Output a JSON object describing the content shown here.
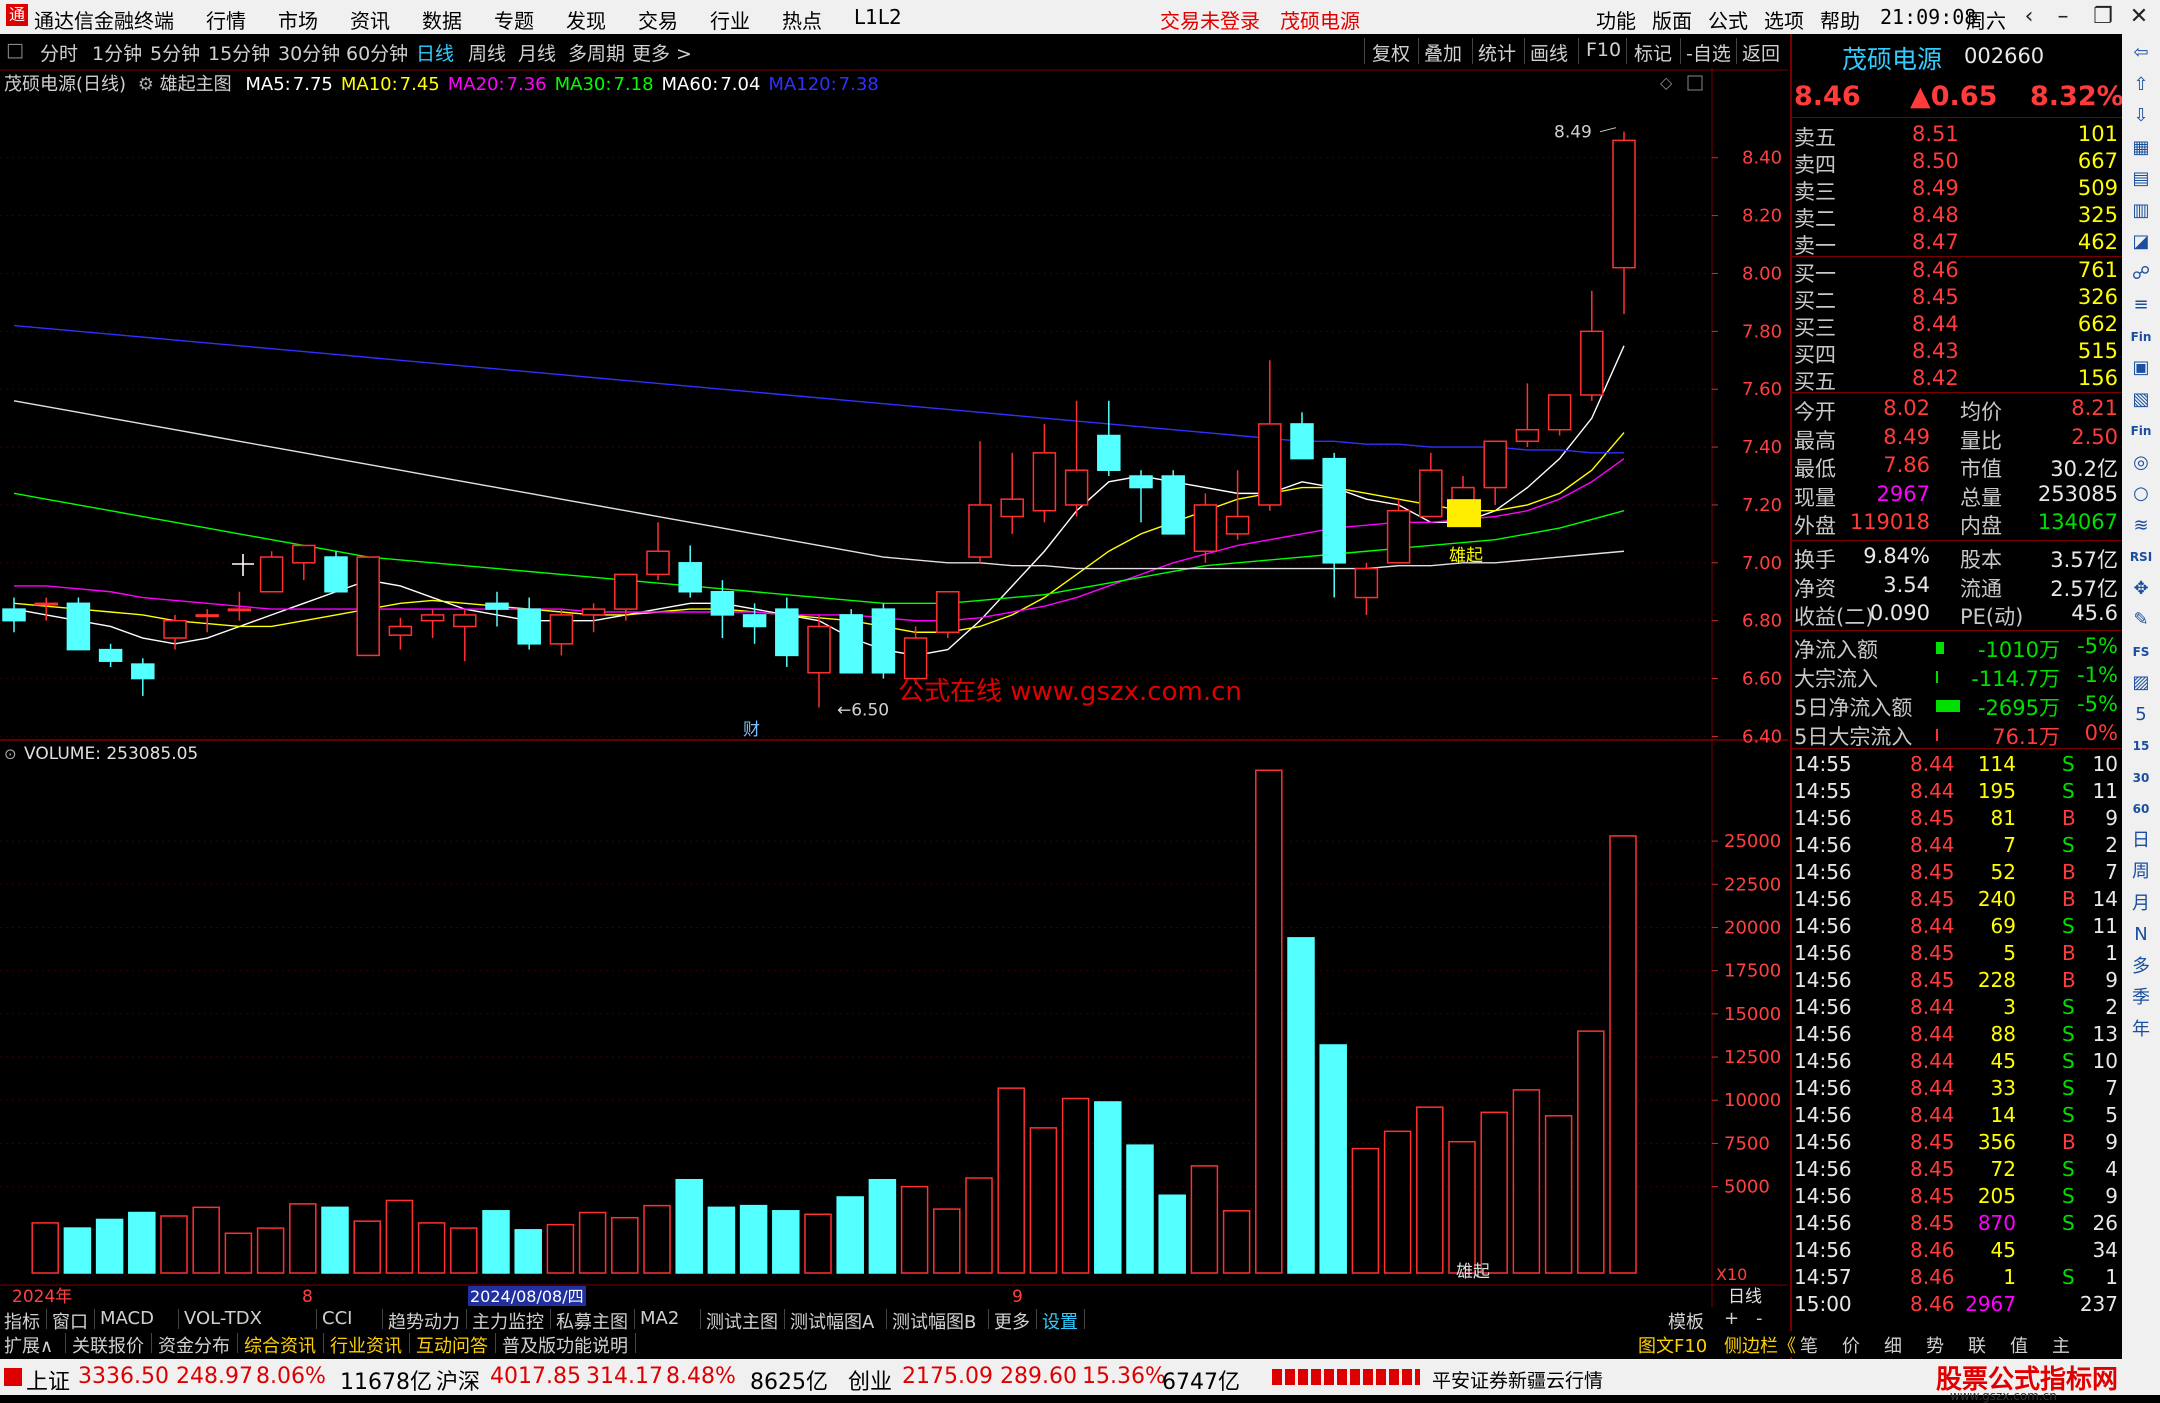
{
  "menubar": {
    "app_title": "通达信金融终端",
    "menus": [
      "行情",
      "市场",
      "资讯",
      "数据",
      "专题",
      "发现",
      "交易",
      "行业",
      "热点",
      "L1L2"
    ],
    "trade_status": "交易未登录",
    "stock_name": "茂硕电源",
    "right_menus": [
      "功能",
      "版面",
      "公式",
      "选项",
      "帮助"
    ],
    "time": "21:09:08",
    "weekday": "周六"
  },
  "periodbar": {
    "periods": [
      "分时",
      "1分钟",
      "5分钟",
      "15分钟",
      "30分钟",
      "60分钟",
      "日线",
      "周线",
      "月线",
      "多周期",
      "更多 >"
    ],
    "active": "日线",
    "right_buttons": [
      "复权",
      "叠加",
      "统计",
      "画线",
      "F10",
      "标记",
      "-自选",
      "返回"
    ]
  },
  "main_chart": {
    "title": "茂硕电源(日线)",
    "indicator": "雄起主图",
    "ma": [
      {
        "label": "MA5:",
        "value": "7.75",
        "color": "#ffffff"
      },
      {
        "label": "MA10:",
        "value": "7.45",
        "color": "#ffff00"
      },
      {
        "label": "MA20:",
        "value": "7.36",
        "color": "#ff00ff"
      },
      {
        "label": "MA30:",
        "value": "7.18",
        "color": "#00ff00"
      },
      {
        "label": "MA60:",
        "value": "7.04",
        "color": "#ffffff"
      },
      {
        "label": "MA120:",
        "value": "7.38",
        "color": "#3030ff"
      }
    ],
    "high_marker": "8.49",
    "low_marker": "6.50",
    "signal_label": "雄起",
    "watermark": "公式在线  www.gszx.com.cn",
    "event_marker": "财",
    "y_ticks": [
      "8.40",
      "8.20",
      "8.00",
      "7.80",
      "7.60",
      "7.40",
      "7.20",
      "7.00",
      "6.80",
      "6.60",
      "6.40"
    ]
  },
  "chart_data": [
    {
      "type": "candlestick",
      "title": "茂硕电源(日线)",
      "ylim": [
        6.36,
        8.52
      ],
      "candles": [
        [
          6.84,
          6.88,
          6.76,
          6.8
        ],
        [
          6.86,
          6.88,
          6.8,
          6.86
        ],
        [
          6.86,
          6.88,
          6.7,
          6.7
        ],
        [
          6.7,
          6.72,
          6.64,
          6.66
        ],
        [
          6.65,
          6.67,
          6.54,
          6.6
        ],
        [
          6.74,
          6.82,
          6.7,
          6.8
        ],
        [
          6.82,
          6.84,
          6.76,
          6.82
        ],
        [
          6.84,
          6.9,
          6.8,
          6.84
        ],
        [
          6.9,
          7.04,
          6.9,
          7.02
        ],
        [
          7.0,
          7.06,
          6.94,
          7.06
        ],
        [
          7.02,
          7.04,
          6.9,
          6.9
        ],
        [
          6.68,
          7.02,
          6.68,
          7.02
        ],
        [
          6.75,
          6.81,
          6.7,
          6.78
        ],
        [
          6.8,
          6.84,
          6.74,
          6.82
        ],
        [
          6.78,
          6.84,
          6.66,
          6.82
        ],
        [
          6.86,
          6.9,
          6.78,
          6.84
        ],
        [
          6.84,
          6.88,
          6.7,
          6.72
        ],
        [
          6.72,
          6.84,
          6.68,
          6.82
        ],
        [
          6.82,
          6.86,
          6.76,
          6.84
        ],
        [
          6.84,
          6.96,
          6.8,
          6.96
        ],
        [
          6.96,
          7.14,
          6.94,
          7.04
        ],
        [
          7.0,
          7.06,
          6.88,
          6.9
        ],
        [
          6.9,
          6.94,
          6.74,
          6.82
        ],
        [
          6.82,
          6.86,
          6.72,
          6.78
        ],
        [
          6.84,
          6.88,
          6.64,
          6.68
        ],
        [
          6.62,
          6.82,
          6.5,
          6.78
        ],
        [
          6.82,
          6.84,
          6.62,
          6.62
        ],
        [
          6.84,
          6.86,
          6.6,
          6.62
        ],
        [
          6.6,
          6.78,
          6.58,
          6.74
        ],
        [
          6.76,
          6.9,
          6.74,
          6.9
        ],
        [
          7.02,
          7.42,
          7.0,
          7.2
        ],
        [
          7.16,
          7.38,
          7.1,
          7.22
        ],
        [
          7.18,
          7.48,
          7.14,
          7.38
        ],
        [
          7.2,
          7.56,
          7.16,
          7.32
        ],
        [
          7.44,
          7.56,
          7.3,
          7.32
        ],
        [
          7.3,
          7.32,
          7.14,
          7.26
        ],
        [
          7.3,
          7.32,
          7.1,
          7.1
        ],
        [
          7.04,
          7.24,
          7.0,
          7.2
        ],
        [
          7.1,
          7.32,
          7.08,
          7.16
        ],
        [
          7.2,
          7.7,
          7.18,
          7.48
        ],
        [
          7.48,
          7.52,
          7.36,
          7.36
        ],
        [
          7.36,
          7.38,
          6.88,
          7.0
        ],
        [
          6.88,
          7.0,
          6.82,
          6.98
        ],
        [
          7.0,
          7.22,
          7.0,
          7.18
        ],
        [
          7.16,
          7.38,
          7.16,
          7.32
        ],
        [
          7.2,
          7.3,
          7.16,
          7.26
        ],
        [
          7.26,
          7.36,
          7.2,
          7.42
        ],
        [
          7.42,
          7.62,
          7.4,
          7.46
        ],
        [
          7.46,
          7.58,
          7.44,
          7.58
        ],
        [
          7.58,
          7.94,
          7.56,
          7.8
        ],
        [
          8.02,
          8.49,
          7.86,
          8.46
        ]
      ],
      "ma": {
        "MA5": [
          6.84,
          6.82,
          6.8,
          6.78,
          6.74,
          6.72,
          6.74,
          6.78,
          6.82,
          6.86,
          6.9,
          6.94,
          6.92,
          6.88,
          6.84,
          6.82,
          6.8,
          6.8,
          6.8,
          6.82,
          6.84,
          6.86,
          6.86,
          6.84,
          6.82,
          6.8,
          6.74,
          6.7,
          6.68,
          6.7,
          6.8,
          6.92,
          7.04,
          7.18,
          7.28,
          7.3,
          7.28,
          7.26,
          7.24,
          7.24,
          7.28,
          7.26,
          7.22,
          7.2,
          7.14,
          7.14,
          7.18,
          7.26,
          7.36,
          7.5,
          7.75
        ],
        "MA10": [
          6.86,
          6.85,
          6.84,
          6.83,
          6.82,
          6.8,
          6.79,
          6.78,
          6.78,
          6.8,
          6.82,
          6.84,
          6.86,
          6.87,
          6.86,
          6.85,
          6.84,
          6.83,
          6.82,
          6.82,
          6.83,
          6.84,
          6.84,
          6.83,
          6.82,
          6.81,
          6.8,
          6.78,
          6.76,
          6.76,
          6.78,
          6.82,
          6.88,
          6.96,
          7.04,
          7.1,
          7.14,
          7.18,
          7.22,
          7.24,
          7.26,
          7.26,
          7.24,
          7.22,
          7.2,
          7.18,
          7.18,
          7.2,
          7.24,
          7.32,
          7.45
        ],
        "MA20": [
          6.92,
          6.92,
          6.91,
          6.9,
          6.88,
          6.87,
          6.86,
          6.85,
          6.84,
          6.84,
          6.84,
          6.84,
          6.84,
          6.84,
          6.84,
          6.84,
          6.84,
          6.84,
          6.83,
          6.83,
          6.83,
          6.83,
          6.83,
          6.83,
          6.82,
          6.82,
          6.82,
          6.81,
          6.8,
          6.8,
          6.81,
          6.83,
          6.85,
          6.88,
          6.92,
          6.96,
          7.0,
          7.03,
          7.06,
          7.08,
          7.1,
          7.12,
          7.13,
          7.14,
          7.14,
          7.15,
          7.16,
          7.18,
          7.22,
          7.28,
          7.36
        ],
        "MA30": [
          7.24,
          7.22,
          7.2,
          7.18,
          7.16,
          7.14,
          7.12,
          7.1,
          7.08,
          7.06,
          7.04,
          7.02,
          7.01,
          7.0,
          6.99,
          6.98,
          6.97,
          6.96,
          6.95,
          6.94,
          6.93,
          6.92,
          6.91,
          6.9,
          6.89,
          6.88,
          6.87,
          6.86,
          6.86,
          6.86,
          6.87,
          6.88,
          6.89,
          6.91,
          6.93,
          6.95,
          6.97,
          6.99,
          7.0,
          7.01,
          7.02,
          7.03,
          7.04,
          7.05,
          7.06,
          7.07,
          7.08,
          7.1,
          7.12,
          7.15,
          7.18
        ],
        "MA60": [
          7.56,
          7.54,
          7.52,
          7.5,
          7.48,
          7.46,
          7.44,
          7.42,
          7.4,
          7.38,
          7.36,
          7.34,
          7.32,
          7.3,
          7.28,
          7.26,
          7.24,
          7.22,
          7.2,
          7.18,
          7.16,
          7.14,
          7.12,
          7.1,
          7.08,
          7.06,
          7.04,
          7.02,
          7.01,
          7.0,
          7.0,
          6.99,
          6.99,
          6.98,
          6.98,
          6.98,
          6.98,
          6.98,
          6.98,
          6.98,
          6.98,
          6.98,
          6.98,
          6.99,
          6.99,
          7.0,
          7.0,
          7.01,
          7.02,
          7.03,
          7.04
        ],
        "MA120": [
          7.82,
          7.81,
          7.8,
          7.79,
          7.78,
          7.77,
          7.76,
          7.75,
          7.74,
          7.73,
          7.72,
          7.71,
          7.7,
          7.69,
          7.68,
          7.67,
          7.66,
          7.65,
          7.64,
          7.63,
          7.62,
          7.61,
          7.6,
          7.59,
          7.58,
          7.57,
          7.56,
          7.55,
          7.54,
          7.53,
          7.52,
          7.51,
          7.5,
          7.49,
          7.48,
          7.47,
          7.46,
          7.45,
          7.44,
          7.43,
          7.42,
          7.42,
          7.41,
          7.41,
          7.4,
          7.4,
          7.4,
          7.39,
          7.39,
          7.38,
          7.38
        ]
      }
    },
    {
      "type": "bar",
      "title": "VOLUME: 253085.05",
      "ylim": [
        0,
        29000
      ],
      "y_ticks": [
        "25000",
        "22500",
        "20000",
        "17500",
        "15000",
        "12500",
        "10000",
        "7500",
        "5000"
      ],
      "x_labels": [
        "2024年",
        "8",
        "2024/08/08/四",
        "9"
      ],
      "multiplier": "X10",
      "values": [
        2900,
        2600,
        3100,
        3500,
        3300,
        3800,
        2300,
        2600,
        4000,
        3800,
        3000,
        4200,
        2900,
        2600,
        3600,
        2500,
        2800,
        3500,
        3200,
        3900,
        5400,
        3800,
        3900,
        3600,
        3400,
        4400,
        5400,
        5000,
        3700,
        5500,
        10700,
        8400,
        10100,
        9900,
        7400,
        4500,
        6200,
        3600,
        29100,
        19400,
        13200,
        7200,
        8200,
        9600,
        7600,
        9300,
        10600,
        9100,
        14000,
        25300
      ]
    }
  ],
  "vol_header": "VOLUME: 253085.05",
  "vol_signal": "雄起",
  "rpanel": {
    "name": "茂硕电源",
    "code": "002660",
    "price": "8.46",
    "change": "▲0.65",
    "change_pct": "8.32%",
    "sells": [
      {
        "label": "卖五",
        "price": "8.51",
        "vol": "101"
      },
      {
        "label": "卖四",
        "price": "8.50",
        "vol": "667"
      },
      {
        "label": "卖三",
        "price": "8.49",
        "vol": "509"
      },
      {
        "label": "卖二",
        "price": "8.48",
        "vol": "325"
      },
      {
        "label": "卖一",
        "price": "8.47",
        "vol": "462"
      }
    ],
    "buys": [
      {
        "label": "买一",
        "price": "8.46",
        "vol": "761"
      },
      {
        "label": "买二",
        "price": "8.45",
        "vol": "326"
      },
      {
        "label": "买三",
        "price": "8.44",
        "vol": "662"
      },
      {
        "label": "买四",
        "price": "8.43",
        "vol": "515"
      },
      {
        "label": "买五",
        "price": "8.42",
        "vol": "156"
      }
    ],
    "stats": [
      {
        "l1": "今开",
        "v1": "8.02",
        "c1": "red",
        "l2": "均价",
        "v2": "8.21",
        "c2": "red"
      },
      {
        "l1": "最高",
        "v1": "8.49",
        "c1": "red",
        "l2": "量比",
        "v2": "2.50",
        "c2": "red"
      },
      {
        "l1": "最低",
        "v1": "7.86",
        "c1": "red",
        "l2": "市值",
        "v2": "30.2亿",
        "c2": "wht"
      },
      {
        "l1": "现量",
        "v1": "2967",
        "c1": "mag",
        "l2": "总量",
        "v2": "253085",
        "c2": "wht"
      },
      {
        "l1": "外盘",
        "v1": "119018",
        "c1": "red",
        "l2": "内盘",
        "v2": "134067",
        "c2": "grn"
      }
    ],
    "stats2": [
      {
        "l1": "换手",
        "v1": "9.84%",
        "l2": "股本",
        "v2": "3.57亿"
      },
      {
        "l1": "净资",
        "v1": "3.54",
        "l2": "流通",
        "v2": "2.57亿"
      },
      {
        "l1": "收益(二)",
        "v1": "0.090",
        "l2": "PE(动)",
        "v2": "45.6"
      }
    ],
    "flows": [
      {
        "label": "净流入额",
        "value": "-1010万",
        "pct": "-5%",
        "color": "grn",
        "bar": 8
      },
      {
        "label": "大宗流入",
        "value": "-114.7万",
        "pct": "-1%",
        "color": "grn",
        "bar": 2
      },
      {
        "label": "5日净流入额",
        "value": "-2695万",
        "pct": "-5%",
        "color": "grn",
        "bar": 24
      },
      {
        "label": "5日大宗流入",
        "value": "76.1万",
        "pct": "0%",
        "color": "red",
        "bar": 2
      }
    ],
    "ticks": [
      [
        "14:55",
        "8.44",
        "114",
        "S",
        "10"
      ],
      [
        "14:55",
        "8.44",
        "195",
        "S",
        "11"
      ],
      [
        "14:56",
        "8.45",
        "81",
        "B",
        "9"
      ],
      [
        "14:56",
        "8.44",
        "7",
        "S",
        "2"
      ],
      [
        "14:56",
        "8.45",
        "52",
        "B",
        "7"
      ],
      [
        "14:56",
        "8.45",
        "240",
        "B",
        "14"
      ],
      [
        "14:56",
        "8.44",
        "69",
        "S",
        "11"
      ],
      [
        "14:56",
        "8.45",
        "5",
        "B",
        "1"
      ],
      [
        "14:56",
        "8.45",
        "228",
        "B",
        "9"
      ],
      [
        "14:56",
        "8.44",
        "3",
        "S",
        "2"
      ],
      [
        "14:56",
        "8.44",
        "88",
        "S",
        "13"
      ],
      [
        "14:56",
        "8.44",
        "45",
        "S",
        "10"
      ],
      [
        "14:56",
        "8.44",
        "33",
        "S",
        "7"
      ],
      [
        "14:56",
        "8.44",
        "14",
        "S",
        "5"
      ],
      [
        "14:56",
        "8.45",
        "356",
        "B",
        "9"
      ],
      [
        "14:56",
        "8.45",
        "72",
        "S",
        "4"
      ],
      [
        "14:56",
        "8.45",
        "205",
        "S",
        "9"
      ],
      [
        "14:56",
        "8.45",
        "870",
        "S",
        "26"
      ],
      [
        "14:56",
        "8.46",
        "45",
        "",
        "34"
      ],
      [
        "14:57",
        "8.46",
        "1",
        "S",
        "1"
      ],
      [
        "15:00",
        "8.46",
        "2967",
        "",
        "237"
      ]
    ]
  },
  "tabbar1": {
    "tabs": [
      "指标",
      "窗口",
      "MACD",
      "VOL-TDX",
      "CCI",
      "趋势动力",
      "主力监控",
      "私募主图",
      "MA2",
      "测试主图",
      "测试幅图A",
      "测试幅图B",
      "更多",
      "设置"
    ],
    "right": [
      "模板",
      "+",
      "-"
    ],
    "period_label": "日线"
  },
  "tabbar2": {
    "tabs": [
      "扩展∧",
      "关联报价",
      "资金分布",
      "综合资讯",
      "行业资讯",
      "互动问答",
      "普及版功能说明"
    ],
    "right": [
      "图文F10",
      "侧边栏《",
      "笔",
      "价",
      "细",
      "势",
      "联",
      "值",
      "主"
    ]
  },
  "statusbar": {
    "sh_label": "上证",
    "sh_val": "3336.50",
    "sh_chg": "248.97",
    "sh_pct": "8.06%",
    "sh_amt": "11678亿",
    "hs_label": "沪深",
    "hs_val": "4017.85",
    "hs_chg": "314.17",
    "hs_pct": "8.48%",
    "hs_amt": "8625亿",
    "cy_label": "创业",
    "cy_val": "2175.09",
    "cy_chg": "289.60",
    "cy_pct": "15.36%",
    "cy_amt": "6747亿",
    "server": "平安证券新疆云行情",
    "brand": "股票公式指标网",
    "brand_url": "www.gszx.com.cn"
  },
  "iconstrip": [
    "⇦",
    "⇧",
    "⇩",
    "▦",
    "▤",
    "▥",
    "◪",
    "☍",
    "≡",
    "Fin",
    "▣",
    "▧",
    "Fin",
    "◎",
    "○",
    "≋",
    "RSI",
    "✥",
    "✎",
    "FS",
    "▨",
    "5",
    "15",
    "30",
    "60",
    "日",
    "周",
    "月",
    "N",
    "多",
    "季",
    "年"
  ]
}
